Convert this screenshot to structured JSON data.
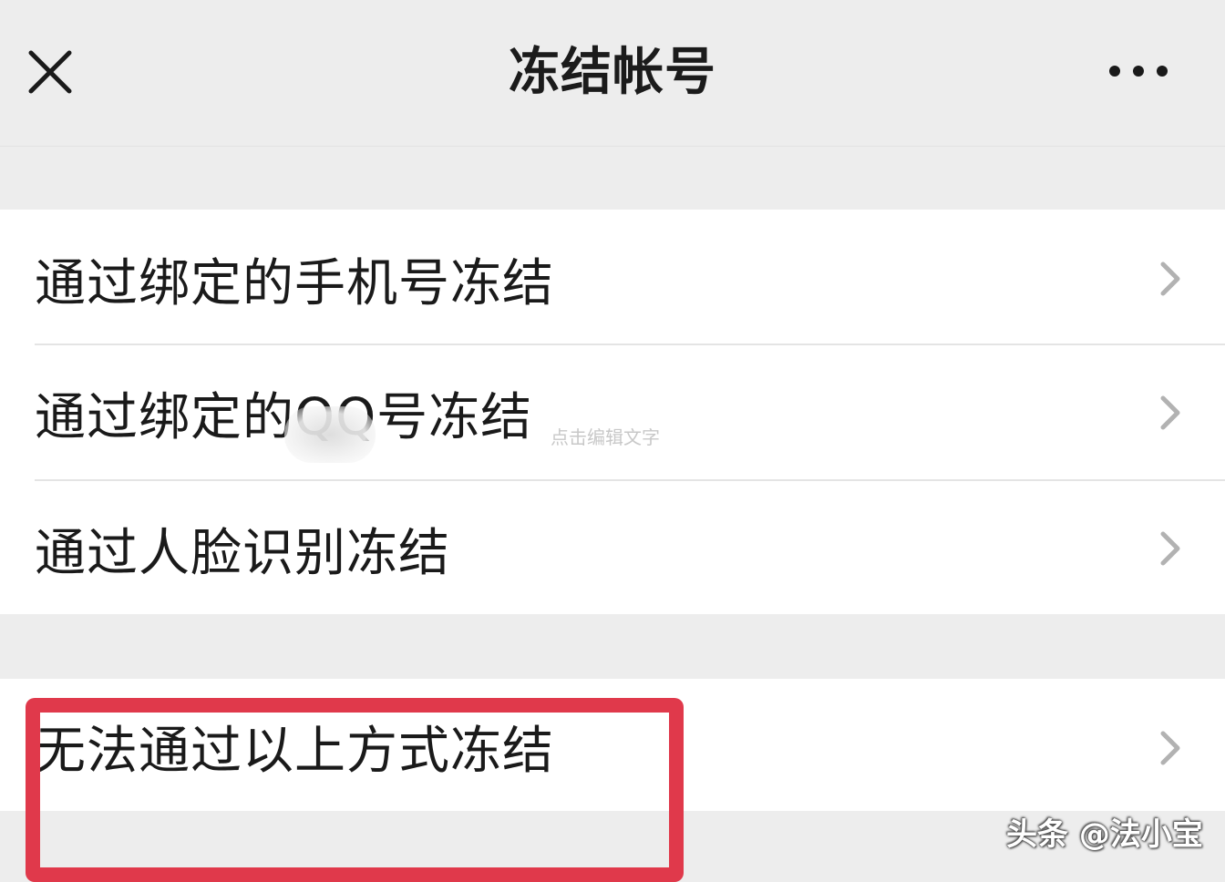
{
  "header": {
    "title": "冻结帐号",
    "close_icon": "close-icon",
    "more_icon": "more-dots-icon"
  },
  "options_group": {
    "items": [
      {
        "label": "通过绑定的手机号冻结",
        "icon": "chevron-right-icon"
      },
      {
        "label": "通过绑定的QQ号冻结",
        "icon": "chevron-right-icon"
      },
      {
        "label": "通过人脸识别冻结",
        "icon": "chevron-right-icon"
      }
    ]
  },
  "fallback_group": {
    "items": [
      {
        "label": "无法通过以上方式冻结",
        "icon": "chevron-right-icon"
      }
    ]
  },
  "edit_hint": "点击编辑文字",
  "watermark": "头条 @法小宝",
  "colors": {
    "background": "#ededed",
    "row_background": "#ffffff",
    "highlight": "#e0394b",
    "chevron": "#b2b2b2"
  }
}
